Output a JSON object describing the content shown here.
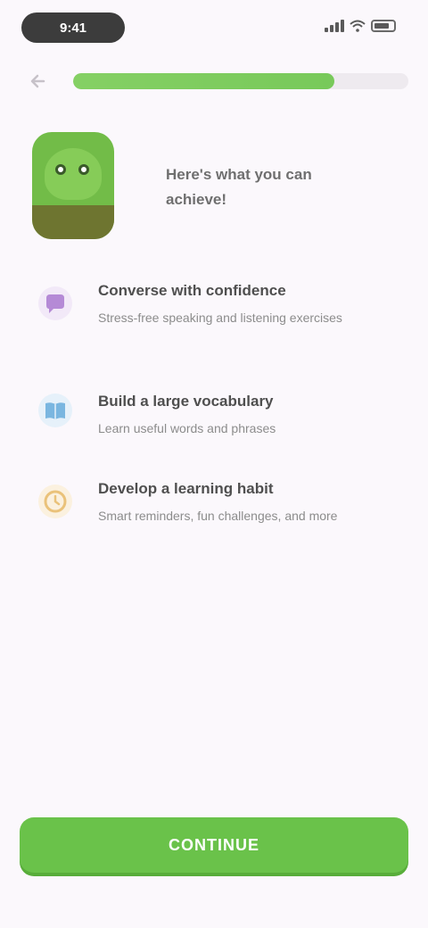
{
  "status_bar": {
    "time": "9:41"
  },
  "progress": {
    "value": 0.78
  },
  "hero": {
    "text": "Here's what you can achieve!"
  },
  "features": [
    {
      "icon": "chat-bubble-icon",
      "color": "#b58ad6",
      "title": "Converse with confidence",
      "desc": "Stress-free speaking and listening exercises"
    },
    {
      "icon": "book-icon",
      "color": "#7ab6e0",
      "title": "Build a large vocabulary",
      "desc": "Learn useful words and phrases"
    },
    {
      "icon": "clock-icon",
      "color": "#eac27a",
      "title": "Develop a learning habit",
      "desc": "Smart reminders, fun challenges, and more"
    }
  ],
  "cta": {
    "label": "CONTINUE",
    "color": "#6ac24a"
  },
  "colors": {
    "brand_green": "#6ac24a",
    "background": "#fbf8fc"
  }
}
